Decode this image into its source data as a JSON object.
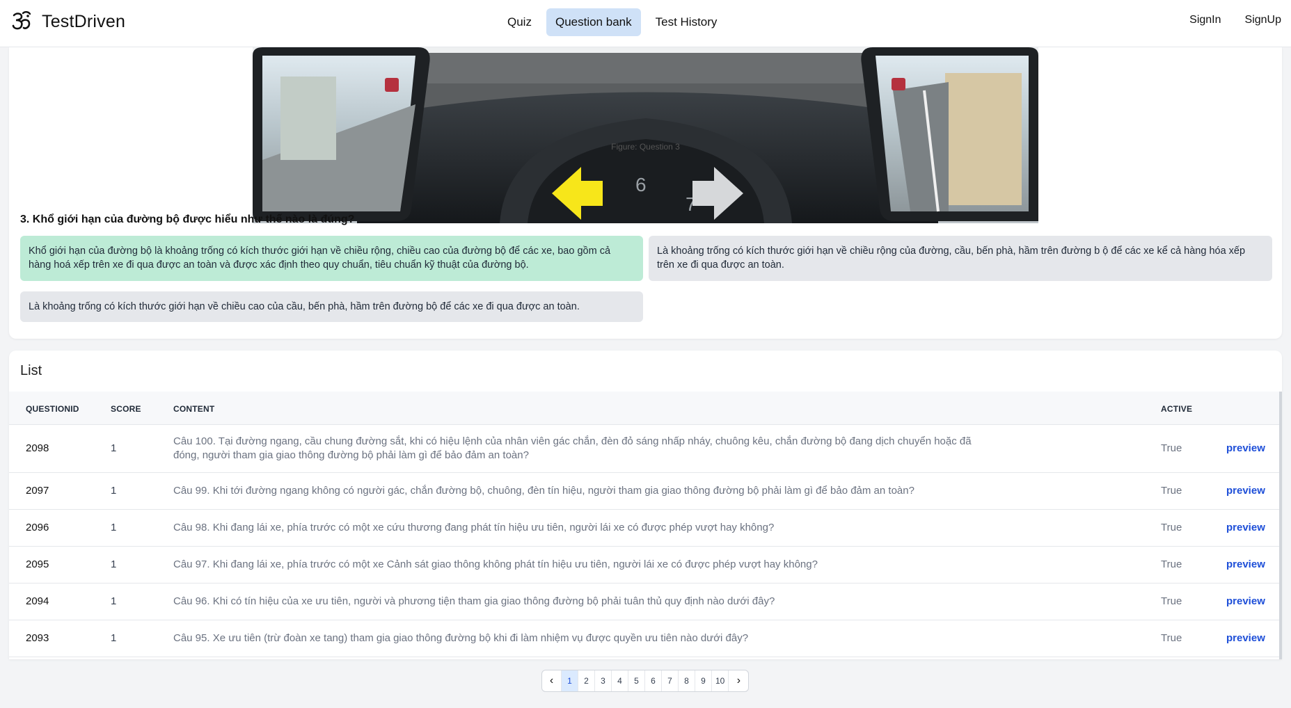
{
  "header": {
    "brand": "TestDriven",
    "nav": [
      {
        "label": "Quiz",
        "active": false
      },
      {
        "label": "Question bank",
        "active": true
      },
      {
        "label": "Test History",
        "active": false
      }
    ],
    "signin": "SignIn",
    "signup": "SignUp"
  },
  "question": {
    "figure_caption": "Figure: Question 3",
    "figure_digits": [
      "6",
      "7"
    ],
    "title": "3. Khổ giới hạn của đường bộ được hiểu như thế nào là đúng?",
    "answers": [
      {
        "text": "Khổ giới hạn của đường bộ là khoảng trống có kích thước giới hạn về chiều rộng, chiều cao của đường bộ để các xe, bao gồm cả hàng hoá xếp trên xe đi qua được an toàn và được xác định theo quy chuẩn, tiêu chuẩn kỹ thuật của đường bộ.",
        "correct": true
      },
      {
        "text": "Là khoảng trống có kích thước giới hạn về chiều rộng của đường, cầu, bến phà, hầm trên đường b ộ để các xe kể cả hàng hóa xếp trên xe đi qua được an toàn.",
        "correct": false
      },
      {
        "text": "Là khoảng trống có kích thước giới hạn về chiều cao của cầu, bến phà, hầm trên đường bộ để các xe đi qua được an toàn.",
        "correct": false
      }
    ],
    "colors": {
      "correct": "#bdebd6",
      "neutral": "#e5e7eb"
    }
  },
  "list": {
    "title": "List",
    "columns": {
      "id": "QUESTIONID",
      "score": "SCORE",
      "content": "CONTENT",
      "active": "ACTIVE"
    },
    "rows": [
      {
        "id": "2098",
        "score": "1",
        "content": "Câu 100. Tại đường ngang, cầu chung đường sắt, khi có hiệu lệnh của nhân viên gác chắn, đèn đỏ sáng nhấp nháy, chuông kêu, chắn đường bộ đang dịch chuyển hoặc đã đóng, người tham gia giao thông đường bộ phải làm gì để bảo đảm an toàn?",
        "active": "True",
        "action": "preview"
      },
      {
        "id": "2097",
        "score": "1",
        "content": "Câu 99. Khi tới đường ngang không có người gác, chắn đường bộ, chuông, đèn tín hiệu, người tham gia giao thông đường bộ phải làm gì để bảo đảm an toàn?",
        "active": "True",
        "action": "preview"
      },
      {
        "id": "2096",
        "score": "1",
        "content": "Câu 98. Khi đang lái xe, phía trước có một xe cứu thương đang phát tín hiệu ưu tiên, người lái xe có được phép vượt hay không?",
        "active": "True",
        "action": "preview"
      },
      {
        "id": "2095",
        "score": "1",
        "content": "Câu 97. Khi đang lái xe, phía trước có một xe Cảnh sát giao thông không phát tín hiệu ưu tiên, người lái xe có được phép vượt hay không?",
        "active": "True",
        "action": "preview"
      },
      {
        "id": "2094",
        "score": "1",
        "content": "Câu 96. Khi có tín hiệu của xe ưu tiên, người và phương tiện tham gia giao thông đường bộ phải tuân thủ quy định nào dưới đây?",
        "active": "True",
        "action": "preview"
      },
      {
        "id": "2093",
        "score": "1",
        "content": "Câu 95. Xe ưu tiên (trừ đoàn xe tang) tham gia giao thông đường bộ khi đi làm nhiệm vụ được quyền ưu tiên nào dưới đây?",
        "active": "True",
        "action": "preview"
      }
    ]
  },
  "pagination": {
    "pages": [
      "1",
      "2",
      "3",
      "4",
      "5",
      "6",
      "7",
      "8",
      "9",
      "10"
    ],
    "current": "1",
    "prev_icon": "chevron-left-icon",
    "next_icon": "chevron-right-icon"
  }
}
